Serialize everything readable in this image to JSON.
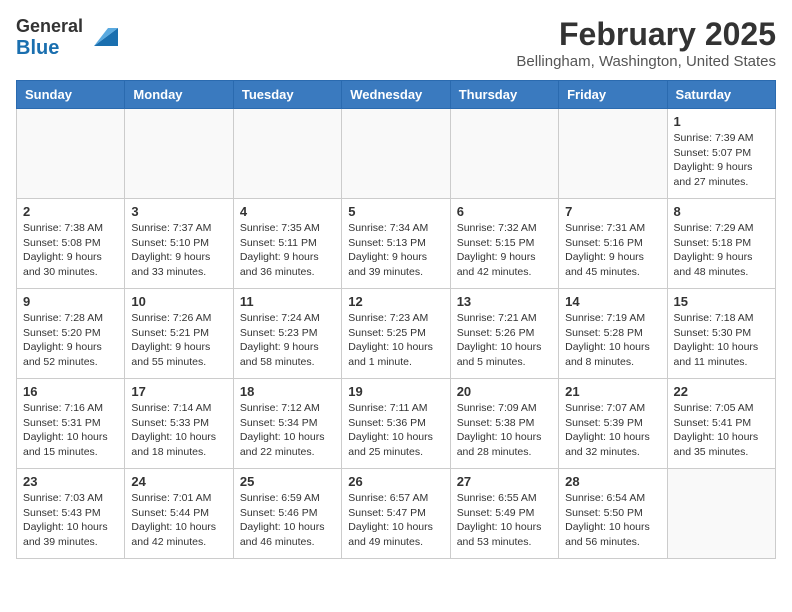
{
  "header": {
    "logo_general": "General",
    "logo_blue": "Blue",
    "month_title": "February 2025",
    "location": "Bellingham, Washington, United States"
  },
  "days_of_week": [
    "Sunday",
    "Monday",
    "Tuesday",
    "Wednesday",
    "Thursday",
    "Friday",
    "Saturday"
  ],
  "weeks": [
    [
      {
        "day": "",
        "info": ""
      },
      {
        "day": "",
        "info": ""
      },
      {
        "day": "",
        "info": ""
      },
      {
        "day": "",
        "info": ""
      },
      {
        "day": "",
        "info": ""
      },
      {
        "day": "",
        "info": ""
      },
      {
        "day": "1",
        "info": "Sunrise: 7:39 AM\nSunset: 5:07 PM\nDaylight: 9 hours and 27 minutes."
      }
    ],
    [
      {
        "day": "2",
        "info": "Sunrise: 7:38 AM\nSunset: 5:08 PM\nDaylight: 9 hours and 30 minutes."
      },
      {
        "day": "3",
        "info": "Sunrise: 7:37 AM\nSunset: 5:10 PM\nDaylight: 9 hours and 33 minutes."
      },
      {
        "day": "4",
        "info": "Sunrise: 7:35 AM\nSunset: 5:11 PM\nDaylight: 9 hours and 36 minutes."
      },
      {
        "day": "5",
        "info": "Sunrise: 7:34 AM\nSunset: 5:13 PM\nDaylight: 9 hours and 39 minutes."
      },
      {
        "day": "6",
        "info": "Sunrise: 7:32 AM\nSunset: 5:15 PM\nDaylight: 9 hours and 42 minutes."
      },
      {
        "day": "7",
        "info": "Sunrise: 7:31 AM\nSunset: 5:16 PM\nDaylight: 9 hours and 45 minutes."
      },
      {
        "day": "8",
        "info": "Sunrise: 7:29 AM\nSunset: 5:18 PM\nDaylight: 9 hours and 48 minutes."
      }
    ],
    [
      {
        "day": "9",
        "info": "Sunrise: 7:28 AM\nSunset: 5:20 PM\nDaylight: 9 hours and 52 minutes."
      },
      {
        "day": "10",
        "info": "Sunrise: 7:26 AM\nSunset: 5:21 PM\nDaylight: 9 hours and 55 minutes."
      },
      {
        "day": "11",
        "info": "Sunrise: 7:24 AM\nSunset: 5:23 PM\nDaylight: 9 hours and 58 minutes."
      },
      {
        "day": "12",
        "info": "Sunrise: 7:23 AM\nSunset: 5:25 PM\nDaylight: 10 hours and 1 minute."
      },
      {
        "day": "13",
        "info": "Sunrise: 7:21 AM\nSunset: 5:26 PM\nDaylight: 10 hours and 5 minutes."
      },
      {
        "day": "14",
        "info": "Sunrise: 7:19 AM\nSunset: 5:28 PM\nDaylight: 10 hours and 8 minutes."
      },
      {
        "day": "15",
        "info": "Sunrise: 7:18 AM\nSunset: 5:30 PM\nDaylight: 10 hours and 11 minutes."
      }
    ],
    [
      {
        "day": "16",
        "info": "Sunrise: 7:16 AM\nSunset: 5:31 PM\nDaylight: 10 hours and 15 minutes."
      },
      {
        "day": "17",
        "info": "Sunrise: 7:14 AM\nSunset: 5:33 PM\nDaylight: 10 hours and 18 minutes."
      },
      {
        "day": "18",
        "info": "Sunrise: 7:12 AM\nSunset: 5:34 PM\nDaylight: 10 hours and 22 minutes."
      },
      {
        "day": "19",
        "info": "Sunrise: 7:11 AM\nSunset: 5:36 PM\nDaylight: 10 hours and 25 minutes."
      },
      {
        "day": "20",
        "info": "Sunrise: 7:09 AM\nSunset: 5:38 PM\nDaylight: 10 hours and 28 minutes."
      },
      {
        "day": "21",
        "info": "Sunrise: 7:07 AM\nSunset: 5:39 PM\nDaylight: 10 hours and 32 minutes."
      },
      {
        "day": "22",
        "info": "Sunrise: 7:05 AM\nSunset: 5:41 PM\nDaylight: 10 hours and 35 minutes."
      }
    ],
    [
      {
        "day": "23",
        "info": "Sunrise: 7:03 AM\nSunset: 5:43 PM\nDaylight: 10 hours and 39 minutes."
      },
      {
        "day": "24",
        "info": "Sunrise: 7:01 AM\nSunset: 5:44 PM\nDaylight: 10 hours and 42 minutes."
      },
      {
        "day": "25",
        "info": "Sunrise: 6:59 AM\nSunset: 5:46 PM\nDaylight: 10 hours and 46 minutes."
      },
      {
        "day": "26",
        "info": "Sunrise: 6:57 AM\nSunset: 5:47 PM\nDaylight: 10 hours and 49 minutes."
      },
      {
        "day": "27",
        "info": "Sunrise: 6:55 AM\nSunset: 5:49 PM\nDaylight: 10 hours and 53 minutes."
      },
      {
        "day": "28",
        "info": "Sunrise: 6:54 AM\nSunset: 5:50 PM\nDaylight: 10 hours and 56 minutes."
      },
      {
        "day": "",
        "info": ""
      }
    ]
  ]
}
